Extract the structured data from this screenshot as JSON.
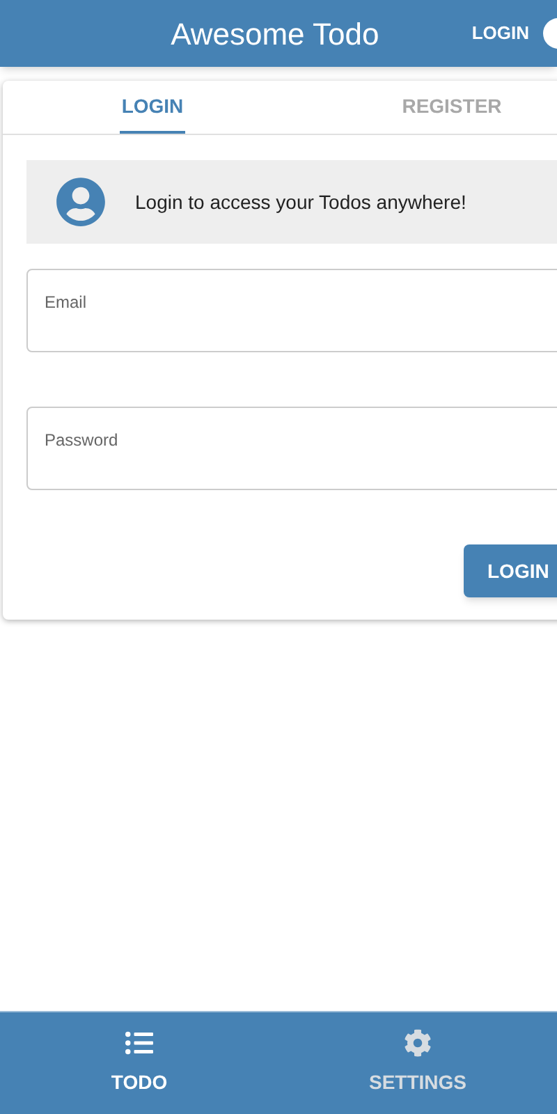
{
  "app_bar": {
    "title": "Awesome Todo",
    "action": "LOGIN"
  },
  "tabs": [
    {
      "label": "LOGIN",
      "selected": true
    },
    {
      "label": "REGISTER",
      "selected": false
    }
  ],
  "banner": {
    "text": "Login to access your Todos anywhere!"
  },
  "fields": [
    {
      "label": "Email"
    },
    {
      "label": "Password"
    }
  ],
  "submit_button": "LOGIN",
  "bottom_nav": [
    {
      "label": "TODO",
      "kind": "list",
      "selected": true
    },
    {
      "label": "SETTINGS",
      "kind": "settings",
      "selected": false
    }
  ]
}
